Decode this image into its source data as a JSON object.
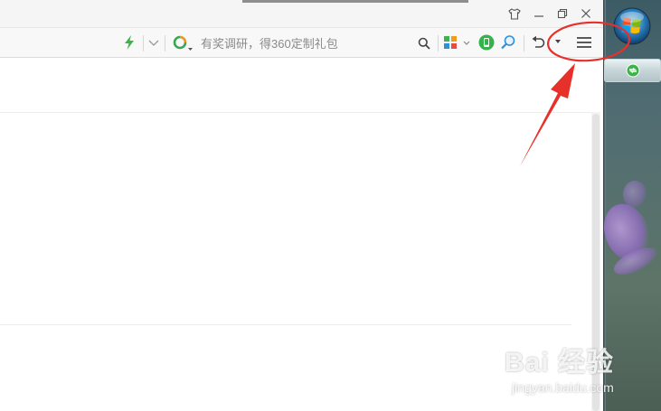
{
  "toolbar": {
    "search_placeholder": "有奖调研，得360定制礼包",
    "icons": {
      "lightning": "lightning-icon",
      "dropdown": "chevron-down-icon",
      "search_engine": "360-search-icon",
      "search": "search-icon",
      "apps": "apps-icon",
      "phone": "phone-icon",
      "magnifier": "magnifier-icon",
      "undo": "undo-icon",
      "menu": "hamburger-menu-icon"
    }
  },
  "titlebar": {
    "icons": {
      "skin": "skin-icon",
      "minimize": "minimize-icon",
      "restore": "restore-icon",
      "close": "close-icon"
    }
  },
  "taskbar": {
    "icons": {
      "start": "windows-start-orb-icon",
      "browser_task": "360-browser-task-icon"
    }
  },
  "watermark": {
    "logo": "Bai 经验",
    "url": "jingyan.baidu.com"
  },
  "colors": {
    "annotation": "#e8302a",
    "lightning": "#3cb44a",
    "search_accent": "#f29a1c",
    "taskbar": "#4f6c72"
  }
}
